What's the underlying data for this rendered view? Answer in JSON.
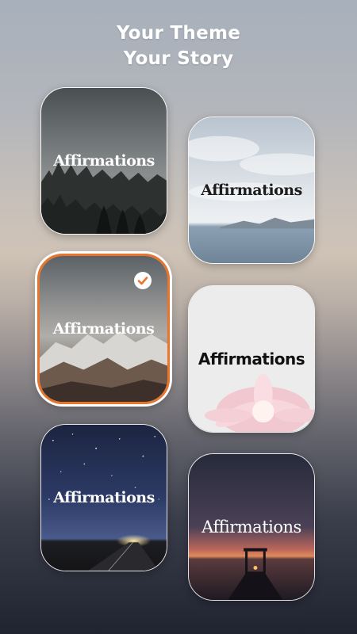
{
  "header": {
    "line1": "Your Theme",
    "line2": "Your Story"
  },
  "themes": [
    {
      "label": "Affirmations",
      "scene": "misty-forest",
      "text_color": "#ffffff",
      "selected": false
    },
    {
      "label": "Affirmations",
      "scene": "sea-clouds",
      "text_color": "#1c1c1c",
      "selected": false
    },
    {
      "label": "Affirmations",
      "scene": "snowy-mountains",
      "text_color": "#ffffff",
      "selected": true
    },
    {
      "label": "Affirmations",
      "scene": "pink-flower",
      "text_color": "#111111",
      "selected": false
    },
    {
      "label": "Affirmations",
      "scene": "starry-road",
      "text_color": "#ffffff",
      "selected": false
    },
    {
      "label": "Affirmations",
      "scene": "sunset-pier",
      "text_color": "#ffffff",
      "selected": false
    }
  ],
  "colors": {
    "selection_accent": "#e9742b",
    "check_icon": "#e9742b"
  }
}
